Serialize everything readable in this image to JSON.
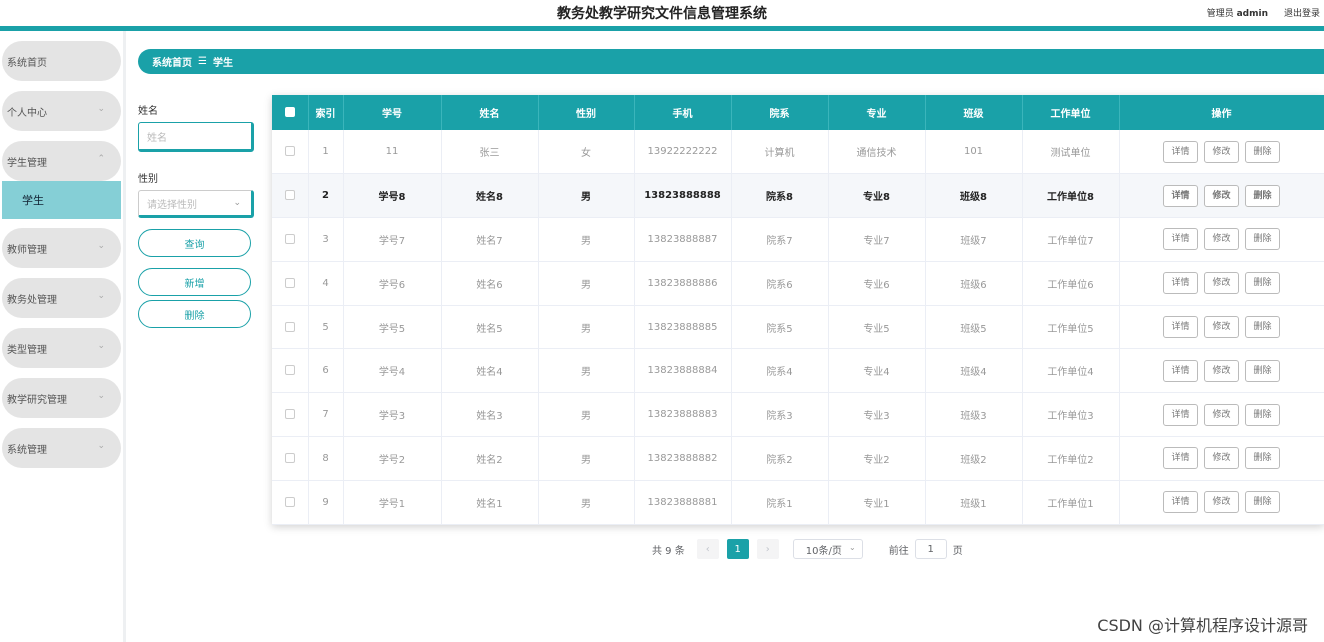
{
  "header": {
    "title": "教务处教学研究文件信息管理系统",
    "user_label": "管理员",
    "user_name": "admin",
    "logout": "退出登录"
  },
  "sidebar": {
    "items": [
      {
        "label": "系统首页"
      },
      {
        "label": "个人中心"
      },
      {
        "label": "学生管理"
      },
      {
        "label": "教师管理"
      },
      {
        "label": "教务处管理"
      },
      {
        "label": "类型管理"
      },
      {
        "label": "教学研究管理"
      },
      {
        "label": "系统管理"
      }
    ],
    "active_sub": "学生"
  },
  "breadcrumb": {
    "home": "系统首页",
    "sep": "☰",
    "current": "学生"
  },
  "search": {
    "name_label": "姓名",
    "name_placeholder": "姓名",
    "gender_label": "性别",
    "gender_placeholder": "请选择性别",
    "query": "查询",
    "add": "新增",
    "delete": "删除"
  },
  "table": {
    "headers": [
      "索引",
      "学号",
      "姓名",
      "性别",
      "手机",
      "院系",
      "专业",
      "班级",
      "工作单位",
      "操作"
    ],
    "actions": {
      "detail": "详情",
      "edit": "修改",
      "delete": "删除"
    },
    "rows": [
      [
        "1",
        "11",
        "张三",
        "女",
        "13922222222",
        "计算机",
        "通信技术",
        "101",
        "测试单位"
      ],
      [
        "2",
        "学号8",
        "姓名8",
        "男",
        "13823888888",
        "院系8",
        "专业8",
        "班级8",
        "工作单位8"
      ],
      [
        "3",
        "学号7",
        "姓名7",
        "男",
        "13823888887",
        "院系7",
        "专业7",
        "班级7",
        "工作单位7"
      ],
      [
        "4",
        "学号6",
        "姓名6",
        "男",
        "13823888886",
        "院系6",
        "专业6",
        "班级6",
        "工作单位6"
      ],
      [
        "5",
        "学号5",
        "姓名5",
        "男",
        "13823888885",
        "院系5",
        "专业5",
        "班级5",
        "工作单位5"
      ],
      [
        "6",
        "学号4",
        "姓名4",
        "男",
        "13823888884",
        "院系4",
        "专业4",
        "班级4",
        "工作单位4"
      ],
      [
        "7",
        "学号3",
        "姓名3",
        "男",
        "13823888883",
        "院系3",
        "专业3",
        "班级3",
        "工作单位3"
      ],
      [
        "8",
        "学号2",
        "姓名2",
        "男",
        "13823888882",
        "院系2",
        "专业2",
        "班级2",
        "工作单位2"
      ],
      [
        "9",
        "学号1",
        "姓名1",
        "男",
        "13823888881",
        "院系1",
        "专业1",
        "班级1",
        "工作单位1"
      ]
    ]
  },
  "pagination": {
    "total": "共 9 条",
    "prev": "‹",
    "current_page": "1",
    "next": "›",
    "page_size": "10条/页",
    "goto_prefix": "前往",
    "goto_value": "1",
    "goto_suffix": "页"
  },
  "watermark": "CSDN @计算机程序设计源哥"
}
